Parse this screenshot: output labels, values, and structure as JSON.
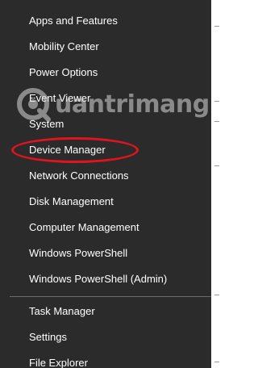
{
  "menu": {
    "items": [
      {
        "label": "Apps and Features"
      },
      {
        "label": "Mobility Center"
      },
      {
        "label": "Power Options"
      },
      {
        "label": "Event Viewer"
      },
      {
        "label": "System"
      },
      {
        "label": "Device Manager"
      },
      {
        "label": "Network Connections"
      },
      {
        "label": "Disk Management"
      },
      {
        "label": "Computer Management"
      },
      {
        "label": "Windows PowerShell"
      },
      {
        "label": "Windows PowerShell (Admin)"
      },
      {
        "label": "Task Manager"
      },
      {
        "label": "Settings"
      },
      {
        "label": "File Explorer"
      }
    ]
  },
  "annotation": {
    "highlight_color": "#e0141e"
  },
  "watermark": {
    "text": "uantrimang"
  },
  "colors": {
    "menu_background": "#2b2b2b",
    "menu_text": "#ffffff",
    "separator": "#6a6a6a"
  }
}
